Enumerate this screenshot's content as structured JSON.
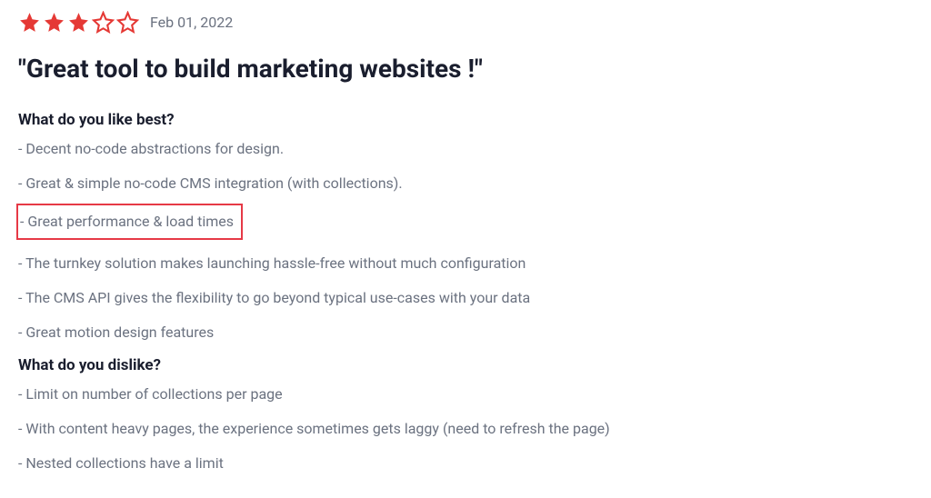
{
  "review": {
    "rating": 3,
    "max_rating": 5,
    "date": "Feb 01, 2022",
    "title": "\"Great tool to build marketing websites !\"",
    "sections": {
      "like": {
        "heading": "What do you like best?",
        "items": [
          "- Decent no-code abstractions for design.",
          "- Great & simple no-code CMS integration (with collections).",
          "- Great performance & load times",
          "- The turnkey solution makes launching hassle-free without much configuration",
          "- The CMS API gives the flexibility to go beyond typical use-cases with your data",
          "- Great motion design features"
        ],
        "highlighted_index": 2
      },
      "dislike": {
        "heading": "What do you dislike?",
        "items": [
          "- Limit on number of collections per page",
          "- With content heavy pages, the experience sometimes gets laggy (need to refresh the page)",
          "- Nested collections have a limit"
        ]
      }
    }
  },
  "colors": {
    "star_fill": "#e53935",
    "star_empty_stroke": "#e53935",
    "highlight_border": "#e63946"
  }
}
